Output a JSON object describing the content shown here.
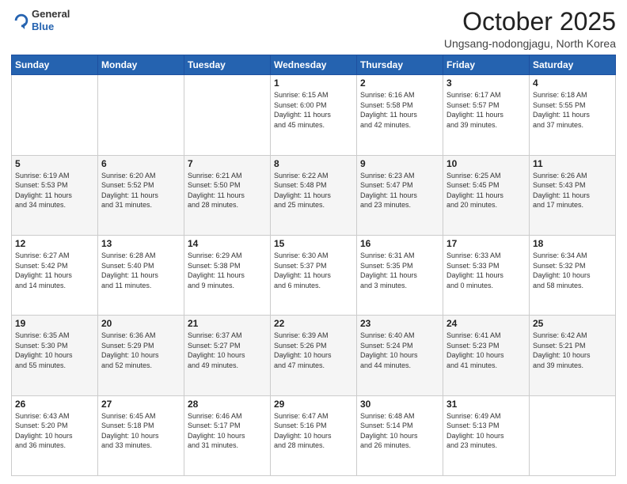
{
  "logo": {
    "general": "General",
    "blue": "Blue"
  },
  "header": {
    "month": "October 2025",
    "location": "Ungsang-nodongjagu, North Korea"
  },
  "weekdays": [
    "Sunday",
    "Monday",
    "Tuesday",
    "Wednesday",
    "Thursday",
    "Friday",
    "Saturday"
  ],
  "weeks": [
    [
      {
        "day": "",
        "info": ""
      },
      {
        "day": "",
        "info": ""
      },
      {
        "day": "",
        "info": ""
      },
      {
        "day": "1",
        "info": "Sunrise: 6:15 AM\nSunset: 6:00 PM\nDaylight: 11 hours\nand 45 minutes."
      },
      {
        "day": "2",
        "info": "Sunrise: 6:16 AM\nSunset: 5:58 PM\nDaylight: 11 hours\nand 42 minutes."
      },
      {
        "day": "3",
        "info": "Sunrise: 6:17 AM\nSunset: 5:57 PM\nDaylight: 11 hours\nand 39 minutes."
      },
      {
        "day": "4",
        "info": "Sunrise: 6:18 AM\nSunset: 5:55 PM\nDaylight: 11 hours\nand 37 minutes."
      }
    ],
    [
      {
        "day": "5",
        "info": "Sunrise: 6:19 AM\nSunset: 5:53 PM\nDaylight: 11 hours\nand 34 minutes."
      },
      {
        "day": "6",
        "info": "Sunrise: 6:20 AM\nSunset: 5:52 PM\nDaylight: 11 hours\nand 31 minutes."
      },
      {
        "day": "7",
        "info": "Sunrise: 6:21 AM\nSunset: 5:50 PM\nDaylight: 11 hours\nand 28 minutes."
      },
      {
        "day": "8",
        "info": "Sunrise: 6:22 AM\nSunset: 5:48 PM\nDaylight: 11 hours\nand 25 minutes."
      },
      {
        "day": "9",
        "info": "Sunrise: 6:23 AM\nSunset: 5:47 PM\nDaylight: 11 hours\nand 23 minutes."
      },
      {
        "day": "10",
        "info": "Sunrise: 6:25 AM\nSunset: 5:45 PM\nDaylight: 11 hours\nand 20 minutes."
      },
      {
        "day": "11",
        "info": "Sunrise: 6:26 AM\nSunset: 5:43 PM\nDaylight: 11 hours\nand 17 minutes."
      }
    ],
    [
      {
        "day": "12",
        "info": "Sunrise: 6:27 AM\nSunset: 5:42 PM\nDaylight: 11 hours\nand 14 minutes."
      },
      {
        "day": "13",
        "info": "Sunrise: 6:28 AM\nSunset: 5:40 PM\nDaylight: 11 hours\nand 11 minutes."
      },
      {
        "day": "14",
        "info": "Sunrise: 6:29 AM\nSunset: 5:38 PM\nDaylight: 11 hours\nand 9 minutes."
      },
      {
        "day": "15",
        "info": "Sunrise: 6:30 AM\nSunset: 5:37 PM\nDaylight: 11 hours\nand 6 minutes."
      },
      {
        "day": "16",
        "info": "Sunrise: 6:31 AM\nSunset: 5:35 PM\nDaylight: 11 hours\nand 3 minutes."
      },
      {
        "day": "17",
        "info": "Sunrise: 6:33 AM\nSunset: 5:33 PM\nDaylight: 11 hours\nand 0 minutes."
      },
      {
        "day": "18",
        "info": "Sunrise: 6:34 AM\nSunset: 5:32 PM\nDaylight: 10 hours\nand 58 minutes."
      }
    ],
    [
      {
        "day": "19",
        "info": "Sunrise: 6:35 AM\nSunset: 5:30 PM\nDaylight: 10 hours\nand 55 minutes."
      },
      {
        "day": "20",
        "info": "Sunrise: 6:36 AM\nSunset: 5:29 PM\nDaylight: 10 hours\nand 52 minutes."
      },
      {
        "day": "21",
        "info": "Sunrise: 6:37 AM\nSunset: 5:27 PM\nDaylight: 10 hours\nand 49 minutes."
      },
      {
        "day": "22",
        "info": "Sunrise: 6:39 AM\nSunset: 5:26 PM\nDaylight: 10 hours\nand 47 minutes."
      },
      {
        "day": "23",
        "info": "Sunrise: 6:40 AM\nSunset: 5:24 PM\nDaylight: 10 hours\nand 44 minutes."
      },
      {
        "day": "24",
        "info": "Sunrise: 6:41 AM\nSunset: 5:23 PM\nDaylight: 10 hours\nand 41 minutes."
      },
      {
        "day": "25",
        "info": "Sunrise: 6:42 AM\nSunset: 5:21 PM\nDaylight: 10 hours\nand 39 minutes."
      }
    ],
    [
      {
        "day": "26",
        "info": "Sunrise: 6:43 AM\nSunset: 5:20 PM\nDaylight: 10 hours\nand 36 minutes."
      },
      {
        "day": "27",
        "info": "Sunrise: 6:45 AM\nSunset: 5:18 PM\nDaylight: 10 hours\nand 33 minutes."
      },
      {
        "day": "28",
        "info": "Sunrise: 6:46 AM\nSunset: 5:17 PM\nDaylight: 10 hours\nand 31 minutes."
      },
      {
        "day": "29",
        "info": "Sunrise: 6:47 AM\nSunset: 5:16 PM\nDaylight: 10 hours\nand 28 minutes."
      },
      {
        "day": "30",
        "info": "Sunrise: 6:48 AM\nSunset: 5:14 PM\nDaylight: 10 hours\nand 26 minutes."
      },
      {
        "day": "31",
        "info": "Sunrise: 6:49 AM\nSunset: 5:13 PM\nDaylight: 10 hours\nand 23 minutes."
      },
      {
        "day": "",
        "info": ""
      }
    ]
  ]
}
